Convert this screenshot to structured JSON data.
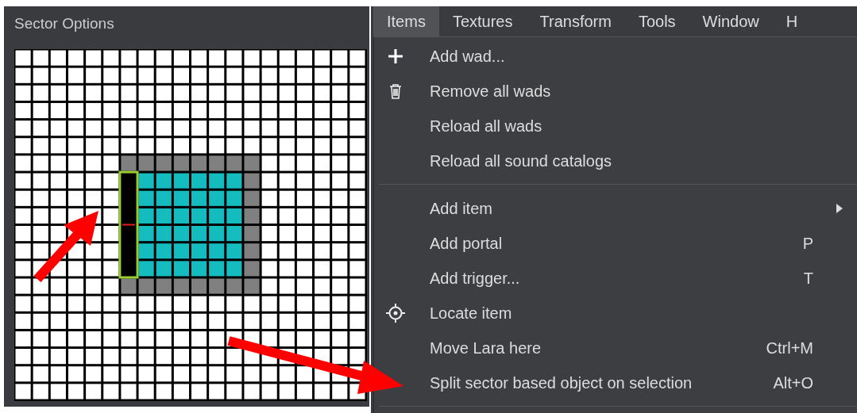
{
  "panel": {
    "title": "Sector Options"
  },
  "menu_bar": [
    {
      "label": "Items",
      "selected": true
    },
    {
      "label": "Textures",
      "selected": false
    },
    {
      "label": "Transform",
      "selected": false
    },
    {
      "label": "Tools",
      "selected": false
    },
    {
      "label": "Window",
      "selected": false
    },
    {
      "label": "H",
      "selected": false
    }
  ],
  "dropdown": [
    {
      "kind": "add",
      "label": "Add wad..."
    },
    {
      "kind": "remove",
      "label": "Remove all wads"
    },
    {
      "kind": "plain",
      "label": "Reload all wads"
    },
    {
      "kind": "plain",
      "label": "Reload all sound catalogs"
    },
    {
      "kind": "separator"
    },
    {
      "kind": "submenu",
      "label": "Add item"
    },
    {
      "kind": "plain",
      "label": "Add portal",
      "shortcut": "P"
    },
    {
      "kind": "plain",
      "label": "Add trigger...",
      "shortcut": "T"
    },
    {
      "kind": "locate",
      "label": "Locate item"
    },
    {
      "kind": "plain",
      "label": "Move Lara here",
      "shortcut": "Ctrl+M"
    },
    {
      "kind": "plain",
      "label": "Split sector based object on selection",
      "shortcut": "Alt+O"
    },
    {
      "kind": "separator"
    }
  ]
}
